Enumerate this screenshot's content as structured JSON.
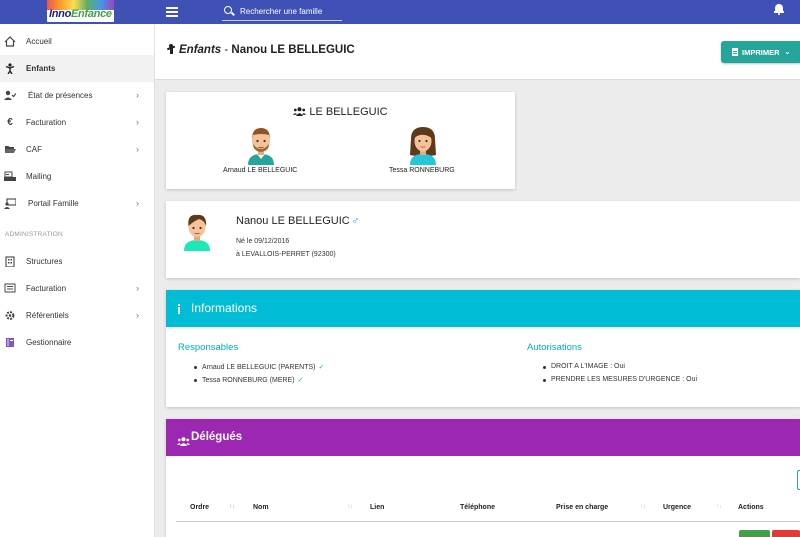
{
  "topbar": {
    "logo_text_a": "Inno",
    "logo_text_b": "Enfance",
    "search_placeholder": "Rechercher une famille"
  },
  "sidebar": {
    "items": [
      {
        "label": "Accueil",
        "icon": "home-icon"
      },
      {
        "label": "Enfants",
        "icon": "child-icon"
      },
      {
        "label": "État de présences",
        "icon": "user-check-icon"
      },
      {
        "label": "Facturation",
        "icon": "euro-icon"
      },
      {
        "label": "CAF",
        "icon": "folder-open-icon"
      },
      {
        "label": "Mailing",
        "icon": "mailing-icon"
      },
      {
        "label": "Portail Famille",
        "icon": "portal-icon"
      }
    ],
    "section_label": "ADMINISTRATION",
    "admin_items": [
      {
        "label": "Structures",
        "icon": "building-icon"
      },
      {
        "label": "Facturation",
        "icon": "list-icon"
      },
      {
        "label": "Référentiels",
        "icon": "gear-icon"
      },
      {
        "label": "Gestionnaire",
        "icon": "book-icon"
      }
    ]
  },
  "header": {
    "title_em": "Enfants",
    "title_sep": " - ",
    "title_name": "Nanou LE BELLEGUIC",
    "print_label": "IMPRIMER"
  },
  "family": {
    "title": "LE BELLEGUIC",
    "members": [
      {
        "name": "Arnaud LE BELLEGUIC",
        "avatar": "male-avatar-icon"
      },
      {
        "name": "Tessa RONNEBURG",
        "avatar": "female-avatar-icon"
      }
    ]
  },
  "child": {
    "name": "Nanou LE BELLEGUIC",
    "gender_symbol": "♂",
    "birth": "Né le 09/12/2016",
    "place": "à LEVALLOIS-PERRET (92300)"
  },
  "informations": {
    "title": "Informations",
    "responsables_title": "Responsables",
    "responsables": [
      "Arnaud LE BELLEGUIC (PARENTS)",
      "Tessa RONNEBURG (MERE)"
    ],
    "autorisations_title": "Autorisations",
    "autorisations": [
      "DROIT A L'IMAGE : Oui",
      "PRENDRE LES MESURES D'URGENCE : Oui"
    ]
  },
  "delegues": {
    "title": "Délégués",
    "columns": [
      "Ordre",
      "Nom",
      "Lien",
      "Téléphone",
      "Prise en charge",
      "Urgence",
      "Actions"
    ]
  },
  "colors": {
    "topbar": "#3f51b5",
    "info_header": "#00bcd4",
    "delegues_header": "#9c27b0",
    "print_button": "#26a69a",
    "male_symbol": "#1e88e5"
  }
}
